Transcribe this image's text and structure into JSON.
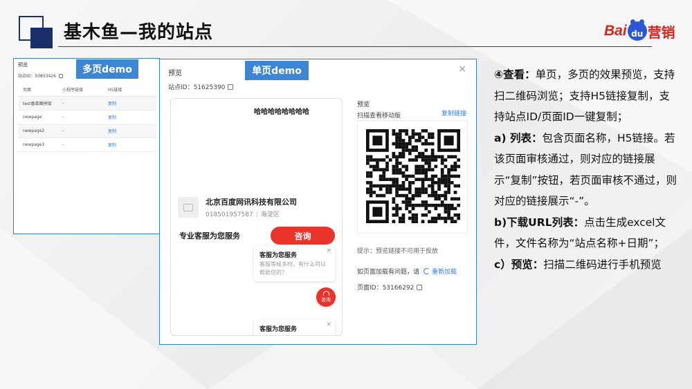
{
  "header": {
    "title": "基木鱼—我的站点",
    "logo_left": "Bai",
    "logo_mid": "du",
    "logo_right": "营销"
  },
  "multi_demo": {
    "tag": "多页demo",
    "panel_title": "预览",
    "site_id": "站点ID：50853426",
    "columns": [
      "页面",
      "小程序链接",
      "H5链接"
    ],
    "rows": [
      {
        "page": "test香菜图拼接",
        "mini": "-",
        "h5": "复制"
      },
      {
        "page": "newpage",
        "mini": "-",
        "h5": "复制"
      },
      {
        "page": "newpage2",
        "mini": "-",
        "h5": "复制"
      },
      {
        "page": "newpage3",
        "mini": "-",
        "h5": "复制"
      }
    ]
  },
  "single_demo": {
    "tag": "单页demo",
    "panel_title": "预览",
    "close": "×",
    "site_id": "站点ID：51625390",
    "phone": {
      "haha": "哈哈哈哈哈哈哈哈",
      "company_name": "北京百度网讯科技有限公司",
      "company_phone": "018501957587",
      "company_district": "海淀区",
      "service_label": "专业客服为您服务",
      "consult_button": "咨询",
      "chat_title": "客服为您服务",
      "chat_desc": "客服等候多时，有什么可以帮助您的？",
      "chat_close": "×",
      "float_label": "咨询",
      "chat2_title": "客服为您服务",
      "chat2_close": "×"
    },
    "preview_label": "预览",
    "scan_label": "扫描查看移动版",
    "copy_link": "复制链接",
    "tip": "提示：预览链接不可用于投放",
    "reload_prompt": "如页面加载有问题，请",
    "reload_link": "重新加载",
    "page_id": "页面ID：53166292"
  },
  "description": {
    "l1_head": "④查看：",
    "l1_text": "单页，多页的效果预览，支持扫二维码浏览；支持H5链接复制，支持站点ID/页面ID一键复制；",
    "l2_head": "a) 列表：",
    "l2_text": "包含页面名称，H5链接。若该页面审核通过，则对应的链接展示“复制”按钮，若页面审核不通过，则对应的链接展示“-”。",
    "l3_head": "b)下载URL列表：",
    "l3_text": "点击生成excel文件，文件名称为“站点名称+日期”；",
    "l4_head": "c）预览：",
    "l4_text": "扫描二维码进行手机预览"
  },
  "colors": {
    "brand_navy": "#1b2f6b",
    "tag_blue": "#3d86d3",
    "consult_red": "#e8342b",
    "link_blue": "#3c7be6"
  }
}
